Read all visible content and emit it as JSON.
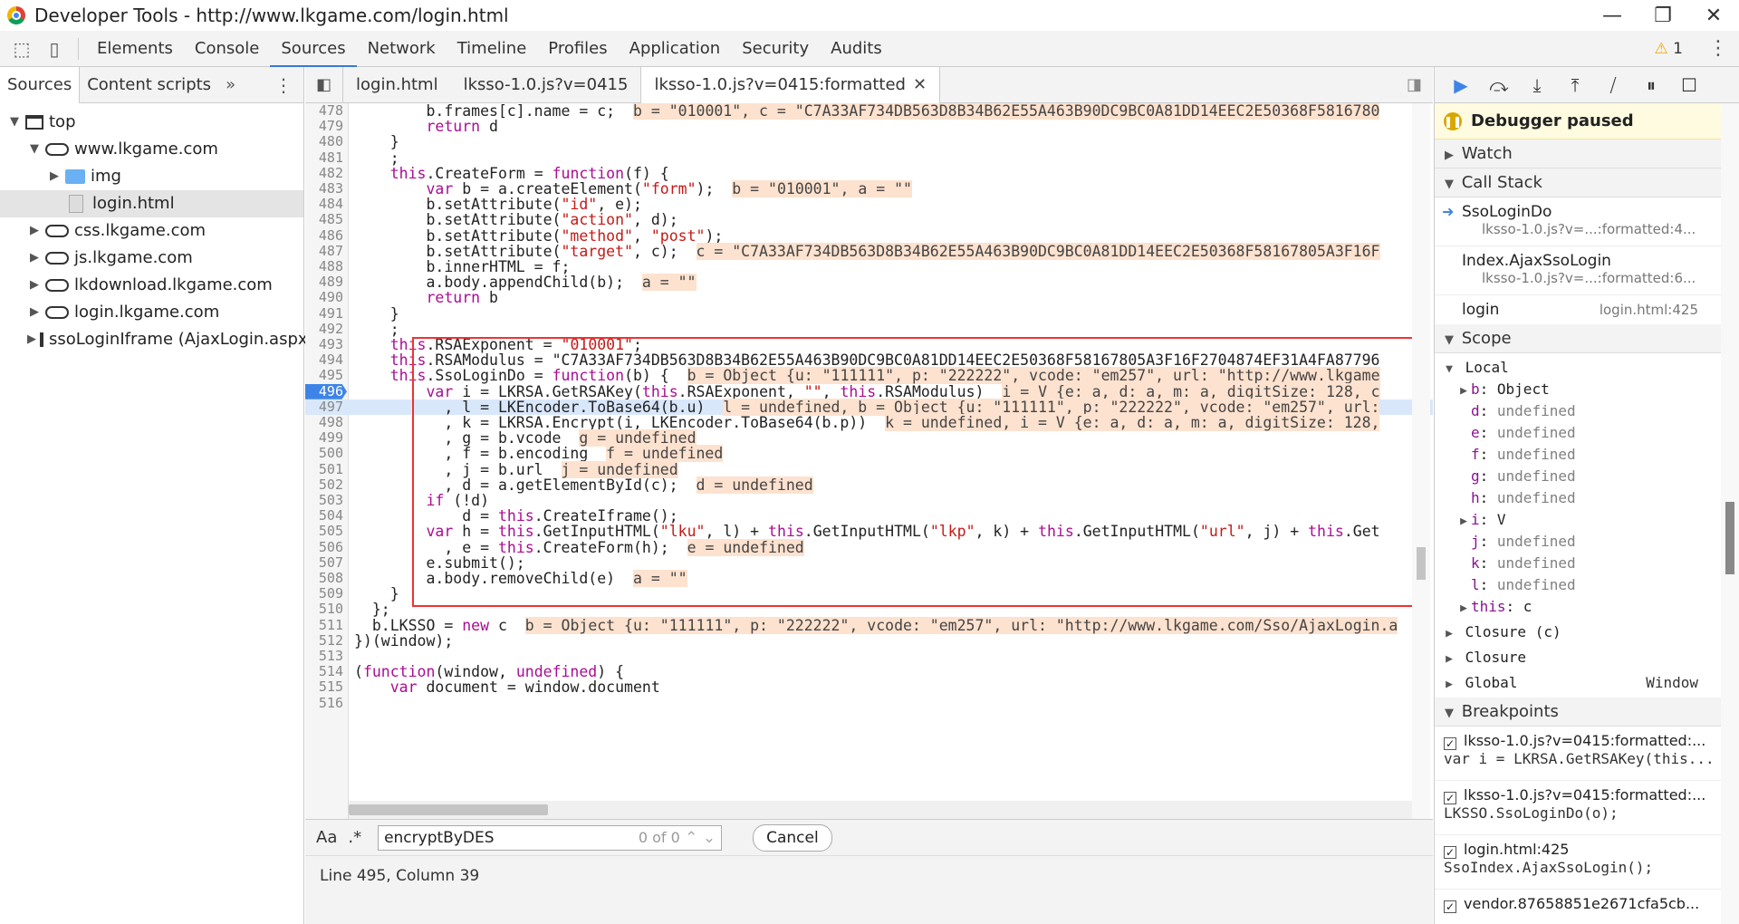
{
  "window": {
    "title": "Developer Tools - http://www.lkgame.com/login.html",
    "controls": [
      "—",
      "❐",
      "✕"
    ]
  },
  "toolbar": {
    "tabs": [
      "Elements",
      "Console",
      "Sources",
      "Network",
      "Timeline",
      "Profiles",
      "Application",
      "Security",
      "Audits"
    ],
    "active": "Sources",
    "warning_count": "1"
  },
  "navigator": {
    "tabs": [
      "Sources",
      "Content scripts"
    ],
    "more": "»",
    "tree": [
      {
        "label": "top",
        "type": "frame",
        "depth": 0,
        "expanded": true
      },
      {
        "label": "www.lkgame.com",
        "type": "cloud",
        "depth": 1,
        "expanded": true
      },
      {
        "label": "img",
        "type": "folder",
        "depth": 2,
        "expanded": false
      },
      {
        "label": "login.html",
        "type": "file",
        "depth": 2,
        "selected": true
      },
      {
        "label": "css.lkgame.com",
        "type": "cloud",
        "depth": 1,
        "expanded": false
      },
      {
        "label": "js.lkgame.com",
        "type": "cloud",
        "depth": 1,
        "expanded": false
      },
      {
        "label": "lkdownload.lkgame.com",
        "type": "cloud",
        "depth": 1,
        "expanded": false
      },
      {
        "label": "login.lkgame.com",
        "type": "cloud",
        "depth": 1,
        "expanded": false
      },
      {
        "label": "ssoLoginIframe (AjaxLogin.aspx)",
        "type": "frame",
        "depth": 1,
        "expanded": false
      }
    ]
  },
  "editor": {
    "tabs": [
      "login.html",
      "lksso-1.0.js?v=0415",
      "lksso-1.0.js?v=0415:formatted"
    ],
    "active_tab": "lksso-1.0.js?v=0415:formatted",
    "lines": [
      {
        "n": "478",
        "code": "        b.frames[c].name = c;",
        "val": "b = \"010001\", c = \"C7A33AF734DB563D8B34B62E55A463B90DC9BC0A81DD14EEC2E50368F5816780"
      },
      {
        "n": "479",
        "code": "        return d"
      },
      {
        "n": "480",
        "code": "    }"
      },
      {
        "n": "481",
        "code": "    ;"
      },
      {
        "n": "482",
        "code": "    this.CreateForm = function(f) {"
      },
      {
        "n": "483",
        "code": "        var b = a.createElement(\"form\");",
        "val": "b = \"010001\", a = \"\""
      },
      {
        "n": "484",
        "code": "        b.setAttribute(\"id\", e);"
      },
      {
        "n": "485",
        "code": "        b.setAttribute(\"action\", d);"
      },
      {
        "n": "486",
        "code": "        b.setAttribute(\"method\", \"post\");"
      },
      {
        "n": "487",
        "code": "        b.setAttribute(\"target\", c);",
        "val": "c = \"C7A33AF734DB563D8B34B62E55A463B90DC9BC0A81DD14EEC2E50368F58167805A3F16F"
      },
      {
        "n": "488",
        "code": "        b.innerHTML = f;"
      },
      {
        "n": "489",
        "code": "        a.body.appendChild(b);",
        "val": "a = \"\""
      },
      {
        "n": "490",
        "code": "        return b"
      },
      {
        "n": "491",
        "code": "    }"
      },
      {
        "n": "492",
        "code": "    ;"
      },
      {
        "n": "493",
        "code": "    this.RSAExponent = \"010001\";"
      },
      {
        "n": "494",
        "code": "    this.RSAModulus = \"C7A33AF734DB563D8B34B62E55A463B90DC9BC0A81DD14EEC2E50368F58167805A3F16F2704874EF31A4FA87796"
      },
      {
        "n": "495",
        "code": "    this.SsoLoginDo = function(b) {",
        "val": "b = Object {u: \"111111\", p: \"222222\", vcode: \"em257\", url: \"http://www.lkgame"
      },
      {
        "n": "496",
        "code": "        var i = LKRSA.GetRSAKey(this.RSAExponent, \"\", this.RSAModulus)",
        "val": "i = V {e: a, d: a, m: a, digitSize: 128, c",
        "bp": true
      },
      {
        "n": "497",
        "code": "          , l = LKEncoder.ToBase64(b.u)",
        "val": "l = undefined, b = Object {u: \"111111\", p: \"222222\", vcode: \"em257\", url:",
        "current": true
      },
      {
        "n": "498",
        "code": "          , k = LKRSA.Encrypt(i, LKEncoder.ToBase64(b.p))",
        "val": "k = undefined, i = V {e: a, d: a, m: a, digitSize: 128,"
      },
      {
        "n": "499",
        "code": "          , g = b.vcode",
        "val": "g = undefined"
      },
      {
        "n": "500",
        "code": "          , f = b.encoding",
        "val": "f = undefined"
      },
      {
        "n": "501",
        "code": "          , j = b.url",
        "val": "j = undefined"
      },
      {
        "n": "502",
        "code": "          , d = a.getElementById(c);",
        "val": "d = undefined"
      },
      {
        "n": "503",
        "code": "        if (!d)"
      },
      {
        "n": "504",
        "code": "            d = this.CreateIframe();"
      },
      {
        "n": "505",
        "code": "        var h = this.GetInputHTML(\"lku\", l) + this.GetInputHTML(\"lkp\", k) + this.GetInputHTML(\"url\", j) + this.Get"
      },
      {
        "n": "506",
        "code": "          , e = this.CreateForm(h);",
        "val": "e = undefined"
      },
      {
        "n": "507",
        "code": "        e.submit();"
      },
      {
        "n": "508",
        "code": "        a.body.removeChild(e)",
        "val": "a = \"\""
      },
      {
        "n": "509",
        "code": "    }"
      },
      {
        "n": "510",
        "code": "  };"
      },
      {
        "n": "511",
        "code": "  b.LKSSO = new c",
        "val": "b = Object {u: \"111111\", p: \"222222\", vcode: \"em257\", url: \"http://www.lkgame.com/Sso/AjaxLogin.a"
      },
      {
        "n": "512",
        "code": "})(window);"
      },
      {
        "n": "513",
        "code": ""
      },
      {
        "n": "514",
        "code": "(function(window, undefined) {"
      },
      {
        "n": "515",
        "code": "    var document = window.document"
      },
      {
        "n": "516",
        "code": ""
      }
    ]
  },
  "find": {
    "case_label": "Aa",
    "regex_label": ".*",
    "query": "encryptByDES",
    "count": "0 of 0",
    "cancel_label": "Cancel"
  },
  "status": {
    "position": "Line 495, Column 39"
  },
  "sidebar": {
    "paused_label": "Debugger paused",
    "watch_label": "Watch",
    "callstack_label": "Call Stack",
    "callstack": [
      {
        "name": "SsoLoginDo",
        "loc": "lksso-1.0.js?v=...:formatted:4...",
        "current": true
      },
      {
        "name": "Index.AjaxSsoLogin",
        "loc": "lksso-1.0.js?v=...:formatted:6..."
      }
    ],
    "callstack_inline": {
      "name": "login",
      "loc": "login.html:425"
    },
    "scope_label": "Scope",
    "scope_local": "Local",
    "scope_vars": [
      {
        "key": "b",
        "val": "Object",
        "expandable": true
      },
      {
        "key": "d",
        "val": "undefined"
      },
      {
        "key": "e",
        "val": "undefined"
      },
      {
        "key": "f",
        "val": "undefined"
      },
      {
        "key": "g",
        "val": "undefined"
      },
      {
        "key": "h",
        "val": "undefined"
      },
      {
        "key": "i",
        "val": "V",
        "expandable": true
      },
      {
        "key": "j",
        "val": "undefined"
      },
      {
        "key": "k",
        "val": "undefined"
      },
      {
        "key": "l",
        "val": "undefined"
      },
      {
        "key": "this",
        "val": "c",
        "expandable": true
      }
    ],
    "scope_groups": [
      {
        "label": "Closure (c)",
        "right": ""
      },
      {
        "label": "Closure",
        "right": ""
      },
      {
        "label": "Global",
        "right": "Window"
      }
    ],
    "breakpoints_label": "Breakpoints",
    "breakpoints": [
      {
        "file": "lksso-1.0.js?v=0415:formatted:...",
        "code": "var i = LKRSA.GetRSAKey(this..."
      },
      {
        "file": "lksso-1.0.js?v=0415:formatted:...",
        "code": "LKSSO.SsoLoginDo(o);"
      },
      {
        "file": "login.html:425",
        "code": "SsoIndex.AjaxSsoLogin();"
      },
      {
        "file": "vendor.87658851e2671cfa5cb...",
        "code": ""
      }
    ]
  }
}
